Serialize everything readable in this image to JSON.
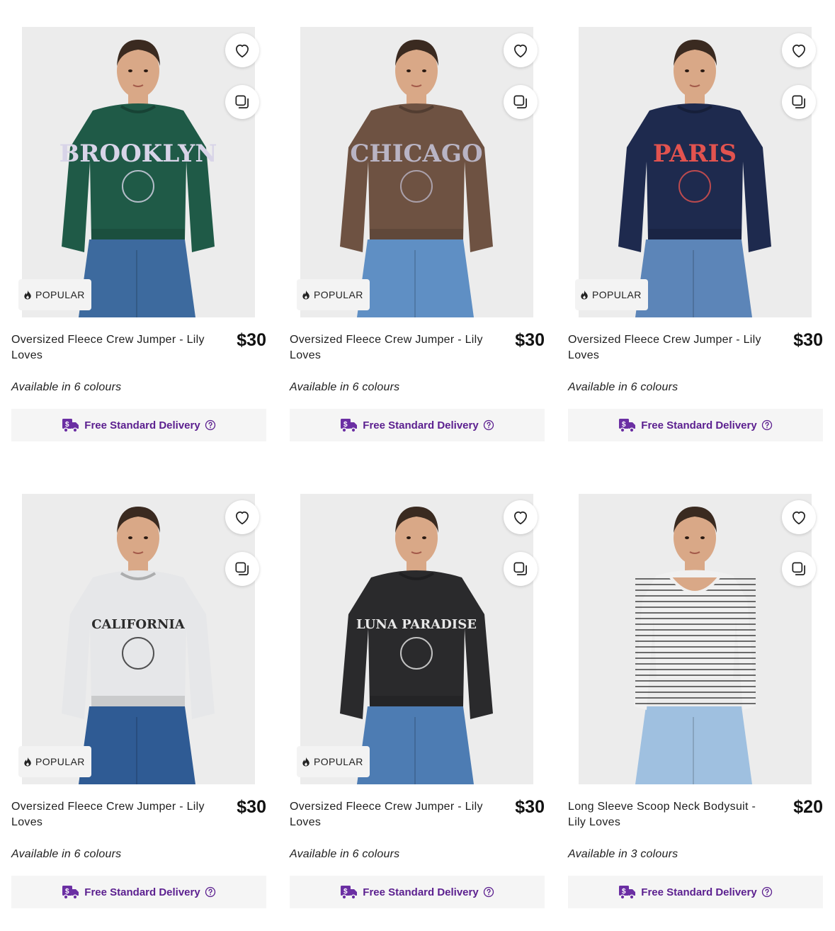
{
  "colors": {
    "accent": "#6b2fa3",
    "delivery_text": "#5b1f8f",
    "badge_bg": "#f3f3f3",
    "delivery_bg": "#f5f5f5"
  },
  "products": [
    {
      "title": "Oversized Fleece Crew Jumper - Lily Loves",
      "price": "$30",
      "colours": "Available in 6 colours",
      "badge": "POPULAR",
      "delivery": "Free Standard Delivery",
      "sweater_color": "#1f5a47",
      "pants_color": "#3d6a9e",
      "print_text": "BROOKLYN",
      "print_color": "#d8d4e8"
    },
    {
      "title": "Oversized Fleece Crew Jumper - Lily Loves",
      "price": "$30",
      "colours": "Available in 6 colours",
      "badge": "POPULAR",
      "delivery": "Free Standard Delivery",
      "sweater_color": "#6e5242",
      "pants_color": "#5f8fc4",
      "print_text": "CHICAGO",
      "print_color": "#b9b4c4"
    },
    {
      "title": "Oversized Fleece Crew Jumper - Lily Loves",
      "price": "$30",
      "colours": "Available in 6 colours",
      "badge": "POPULAR",
      "delivery": "Free Standard Delivery",
      "sweater_color": "#1e2a4e",
      "pants_color": "#5c85b8",
      "print_text": "PARIS",
      "print_color": "#e2534f"
    },
    {
      "title": "Oversized Fleece Crew Jumper - Lily Loves",
      "price": "$30",
      "colours": "Available in 6 colours",
      "badge": "POPULAR",
      "delivery": "Free Standard Delivery",
      "sweater_color": "#e6e7e9",
      "pants_color": "#2f5b94",
      "print_text": "CALIFORNIA",
      "print_color": "#2b2b2b"
    },
    {
      "title": "Oversized Fleece Crew Jumper - Lily Loves",
      "price": "$30",
      "colours": "Available in 6 colours",
      "badge": "POPULAR",
      "delivery": "Free Standard Delivery",
      "sweater_color": "#2a2a2c",
      "pants_color": "#4d7cb3",
      "print_text": "LUNA PARADISE",
      "print_color": "#e8e8e8"
    },
    {
      "title": "Long Sleeve Scoop Neck Bodysuit - Lily Loves",
      "price": "$20",
      "colours": "Available in 3 colours",
      "badge": "",
      "delivery": "Free Standard Delivery",
      "sweater_color": "#f0f0f0",
      "pants_color": "#9fc0e0",
      "print_text": "",
      "print_color": "#444444"
    }
  ]
}
